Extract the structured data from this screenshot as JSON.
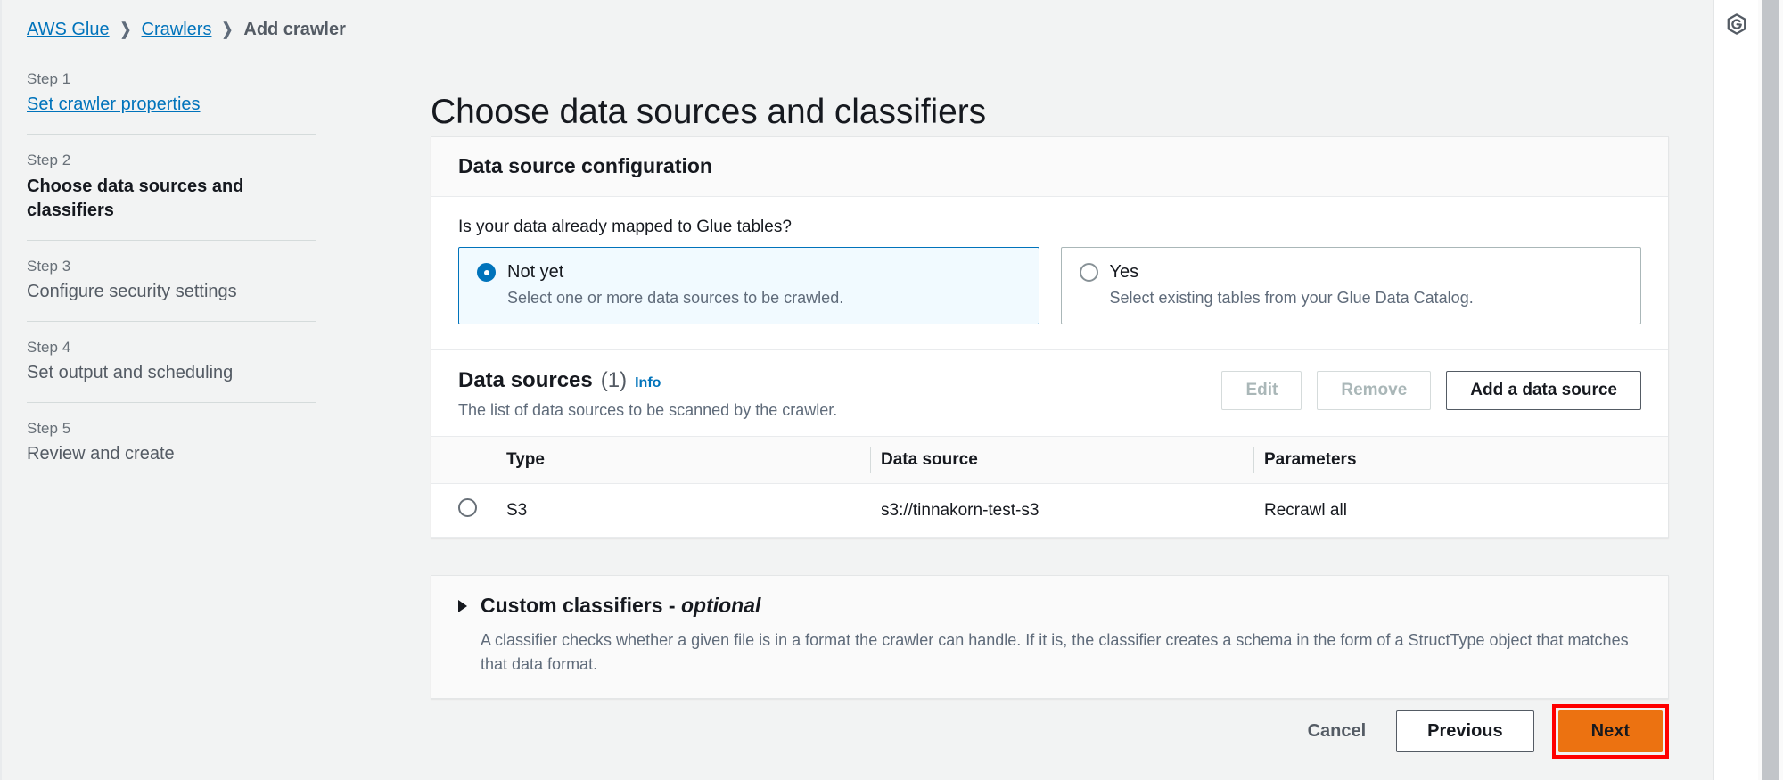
{
  "breadcrumb": {
    "items": [
      {
        "label": "AWS Glue",
        "type": "link"
      },
      {
        "label": "Crawlers",
        "type": "link"
      },
      {
        "label": "Add crawler",
        "type": "current"
      }
    ],
    "separator": "❯"
  },
  "stepnav": {
    "steps": [
      {
        "num": "Step 1",
        "title": "Set crawler properties",
        "state": "link"
      },
      {
        "num": "Step 2",
        "title": "Choose data sources and classifiers",
        "state": "active"
      },
      {
        "num": "Step 3",
        "title": "Configure security settings",
        "state": "inactive"
      },
      {
        "num": "Step 4",
        "title": "Set output and scheduling",
        "state": "inactive"
      },
      {
        "num": "Step 5",
        "title": "Review and create",
        "state": "inactive"
      }
    ]
  },
  "page": {
    "title": "Choose data sources and classifiers"
  },
  "card": {
    "header": "Data source configuration",
    "question": "Is your data already mapped to Glue tables?",
    "options": [
      {
        "label": "Not yet",
        "description": "Select one or more data sources to be crawled.",
        "selected": true
      },
      {
        "label": "Yes",
        "description": "Select existing tables from your Glue Data Catalog.",
        "selected": false
      }
    ]
  },
  "data_sources": {
    "title": "Data sources",
    "count": "(1)",
    "info_label": "Info",
    "description": "The list of data sources to be scanned by the crawler.",
    "buttons": [
      {
        "label": "Edit",
        "state": "disabled"
      },
      {
        "label": "Remove",
        "state": "disabled"
      },
      {
        "label": "Add a data source",
        "state": "enabled"
      }
    ],
    "columns": [
      "",
      "Type",
      "Data source",
      "Parameters"
    ],
    "rows": [
      {
        "type": "S3",
        "source": "s3://tinnakorn-test-s3",
        "parameters": "Recrawl all",
        "selected": false
      }
    ]
  },
  "classifiers": {
    "title": "Custom classifiers - ",
    "title_optional": "optional",
    "description": "A classifier checks whether a given file is in a format the crawler can handle. If it is, the classifier creates a schema in the form of a StructType object that matches that data format.",
    "expanded": false
  },
  "footer": {
    "cancel_label": "Cancel",
    "previous_label": "Previous",
    "next_label": "Next",
    "next_highlight_color": "#ff0000"
  },
  "right_rail": {
    "icon": "glue-hexagon-icon"
  },
  "colors": {
    "link": "#0073bb",
    "accent_orange": "#ec7211",
    "page_bg": "#f2f3f3",
    "selected_bg": "#f1faff"
  }
}
